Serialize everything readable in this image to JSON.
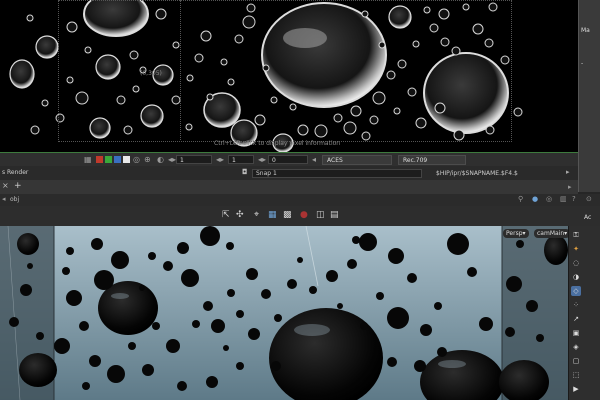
{
  "render_view": {
    "resolution_label": "(0,305)",
    "hint_text": "Ctrl+Left click to display pixel information"
  },
  "render_toolbar": {
    "field_frame": "1",
    "field_step": "1",
    "field_zero": "0",
    "colorspace": "ACES",
    "display": "Rec.709",
    "swatch_colors": [
      "#c0392b",
      "#3aa83a",
      "#3a6fc0",
      "#e8e8e8"
    ]
  },
  "right_strip": {
    "top_text": "Ma",
    "mid_text": "-",
    "lower_text": "Ac"
  },
  "snapshot_row": {
    "tab_label": "s Render",
    "snapshot_value": "Snap 1",
    "output_path": "$HIP/ipr/$SNAPNAME.$F4.$"
  },
  "pane_tabs": {
    "close_glyph": "×",
    "add_glyph": "+"
  },
  "path_bar": {
    "path": "obj"
  },
  "viewport": {
    "persp_label": "Persp▾",
    "camera_label": "camMain▾"
  },
  "colors": {
    "accent_green": "#3d7a3d",
    "panel_bg": "#262626"
  }
}
